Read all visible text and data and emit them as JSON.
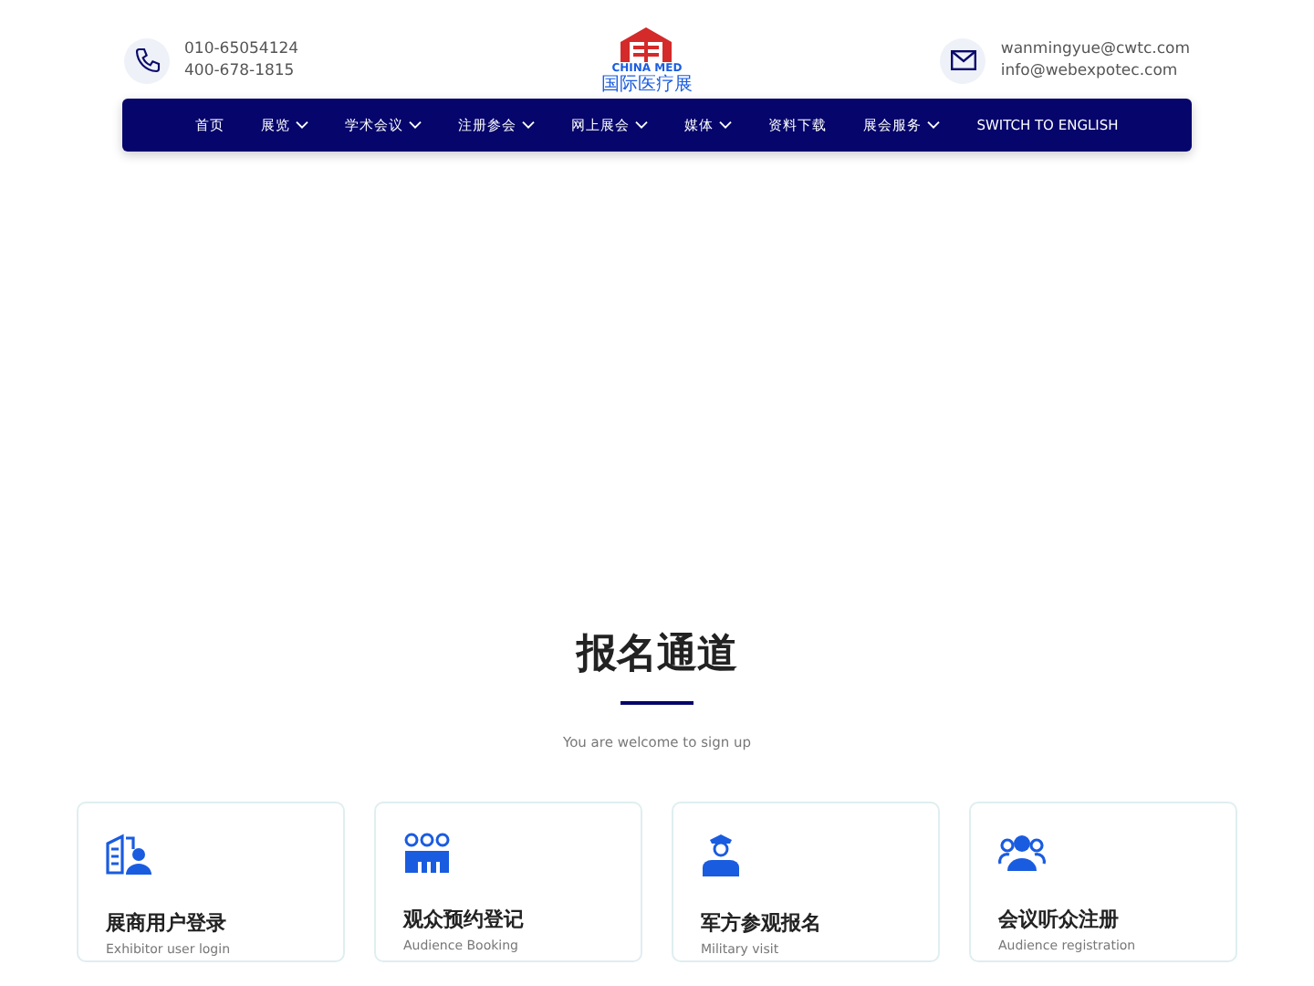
{
  "header": {
    "phones": [
      "010-65054124",
      "400-678-1815"
    ],
    "logo": {
      "wordmark": "CHINA MED",
      "subtitle": "国际医疗展"
    },
    "emails": [
      "wanmingyue@cwtc.com",
      "info@webexpotec.com"
    ]
  },
  "nav": [
    {
      "label": "首页",
      "dropdown": false
    },
    {
      "label": "展览",
      "dropdown": true
    },
    {
      "label": "学术会议",
      "dropdown": true
    },
    {
      "label": "注册参会",
      "dropdown": true
    },
    {
      "label": "网上展会",
      "dropdown": true
    },
    {
      "label": "媒体",
      "dropdown": true
    },
    {
      "label": "资料下载",
      "dropdown": false
    },
    {
      "label": "展会服务",
      "dropdown": true
    },
    {
      "label": "SWITCH TO ENGLISH",
      "dropdown": false
    }
  ],
  "section": {
    "title": "报名通道",
    "subtitle": "You are welcome to sign up"
  },
  "cards": [
    {
      "kind": "exhibitor",
      "title": "展商用户登录",
      "subtitle": "Exhibitor user login"
    },
    {
      "kind": "audience",
      "title": "观众预约登记",
      "subtitle": "Audience Booking"
    },
    {
      "kind": "military",
      "title": "军方参观报名",
      "subtitle": "Military visit"
    },
    {
      "kind": "conference",
      "title": "会议听众注册",
      "subtitle": "Audience registration"
    }
  ]
}
